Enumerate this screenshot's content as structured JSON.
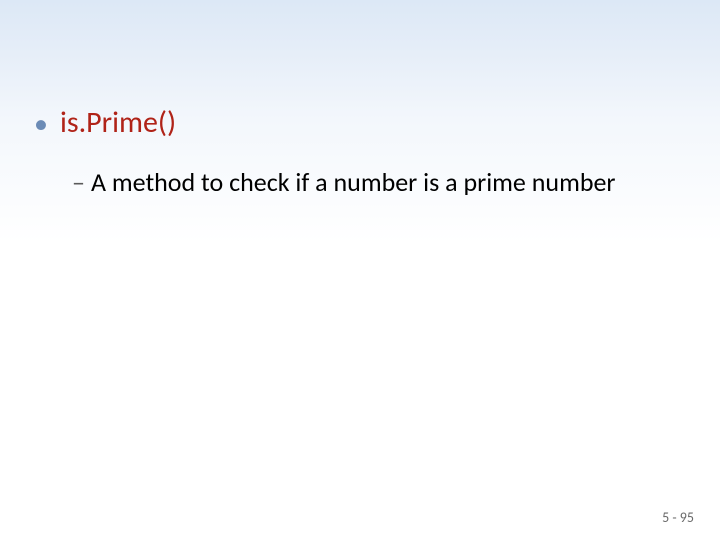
{
  "slide": {
    "bullet1": {
      "text": "is.Prime()"
    },
    "sub1": {
      "dash": "–",
      "text": "A method to check if a number is a prime number"
    },
    "footer": "5 - 95"
  }
}
